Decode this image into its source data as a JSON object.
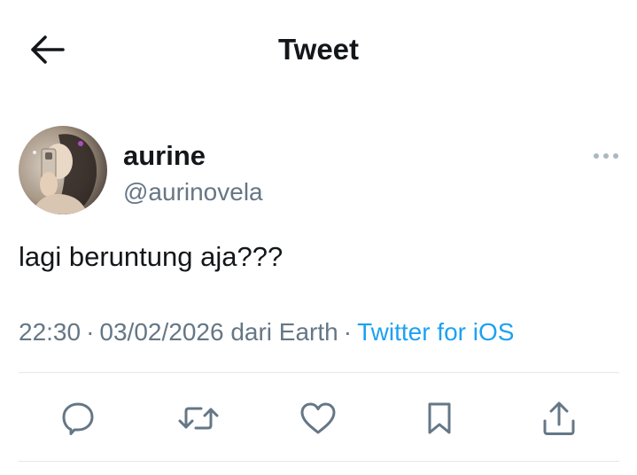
{
  "header": {
    "title": "Tweet",
    "back_icon": "arrow-left-icon"
  },
  "author": {
    "display_name": "aurine",
    "handle": "@aurinovela",
    "more_icon": "more-horizontal-icon"
  },
  "tweet": {
    "text": "lagi beruntung aja???",
    "time": "22:30",
    "date": "03/02/2026",
    "location": "dari Earth",
    "separator": "·",
    "source": "Twitter for iOS"
  },
  "actions": {
    "reply_icon": "reply-icon",
    "retweet_icon": "retweet-icon",
    "like_icon": "heart-icon",
    "bookmark_icon": "bookmark-icon",
    "share_icon": "share-icon"
  },
  "colors": {
    "text_primary": "#14171a",
    "text_secondary": "#657786",
    "link": "#1da1f2",
    "divider": "#e1e8ed"
  }
}
